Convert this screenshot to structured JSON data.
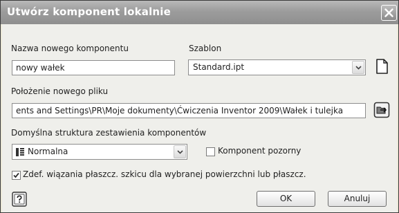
{
  "dialog": {
    "title": "Utwórz komponent lokalnie",
    "name_label": "Nazwa nowego komponentu",
    "name_value": "nowy wałek",
    "template_label": "Szablon",
    "template_value": "Standard.ipt",
    "location_label": "Położenie nowego pliku",
    "location_value": "ents and Settings\\PR\\Moje dokumenty\\Ćwiczenia Inventor 2009\\Wałek i tulejka",
    "bom_label": "Domyślna struktura zestawienia komponentów",
    "bom_value": "Normalna",
    "virtual_label": "Komponent pozorny",
    "virtual_checked": false,
    "constrain_label": "Zdef. wiązania płaszcz. szkicu dla wybranej powierzchni lub płaszcz.",
    "constrain_checked": true,
    "ok_label": "OK",
    "cancel_label": "Anuluj"
  },
  "icons": [
    "close-icon",
    "new-template-icon",
    "browse-folder-icon",
    "bom-structure-icon",
    "help-icon",
    "chevron-down-icon",
    "check-icon"
  ]
}
